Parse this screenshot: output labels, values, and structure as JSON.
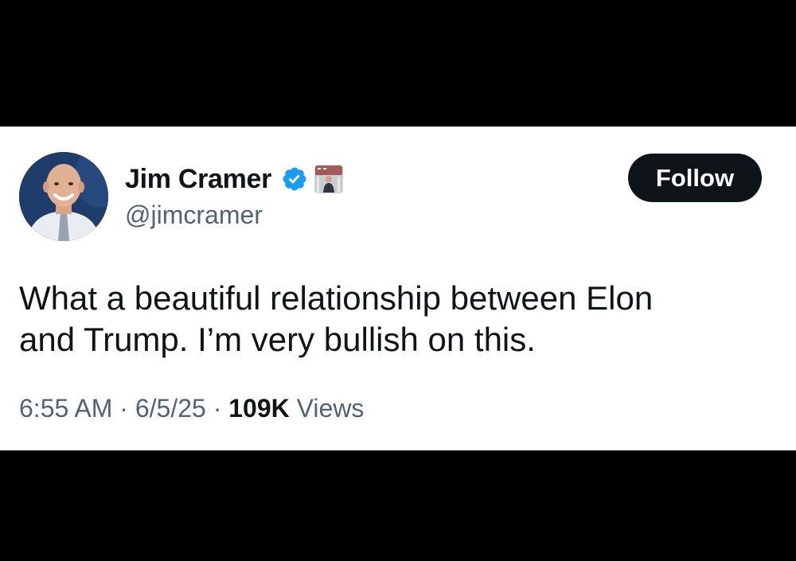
{
  "tweet": {
    "author_name": "Jim Cramer",
    "author_handle": "@jimcramer",
    "verified_icon": "verified-badge-icon",
    "affiliate_badge": "affiliate-badge-image",
    "follow_label": "Follow",
    "text_line1": "What a beautiful relationship between Elon",
    "text_line2": "and Trump. I’m very bullish on this.",
    "time": "6:55 AM",
    "separator": "·",
    "date": "6/5/25",
    "views_count": "109K",
    "views_label": "Views"
  },
  "colors": {
    "background": "#000000",
    "card": "#ffffff",
    "text_primary": "#0f1419",
    "text_secondary": "#536471",
    "verified_blue": "#1d9bf0",
    "button_bg": "#0f1419"
  }
}
